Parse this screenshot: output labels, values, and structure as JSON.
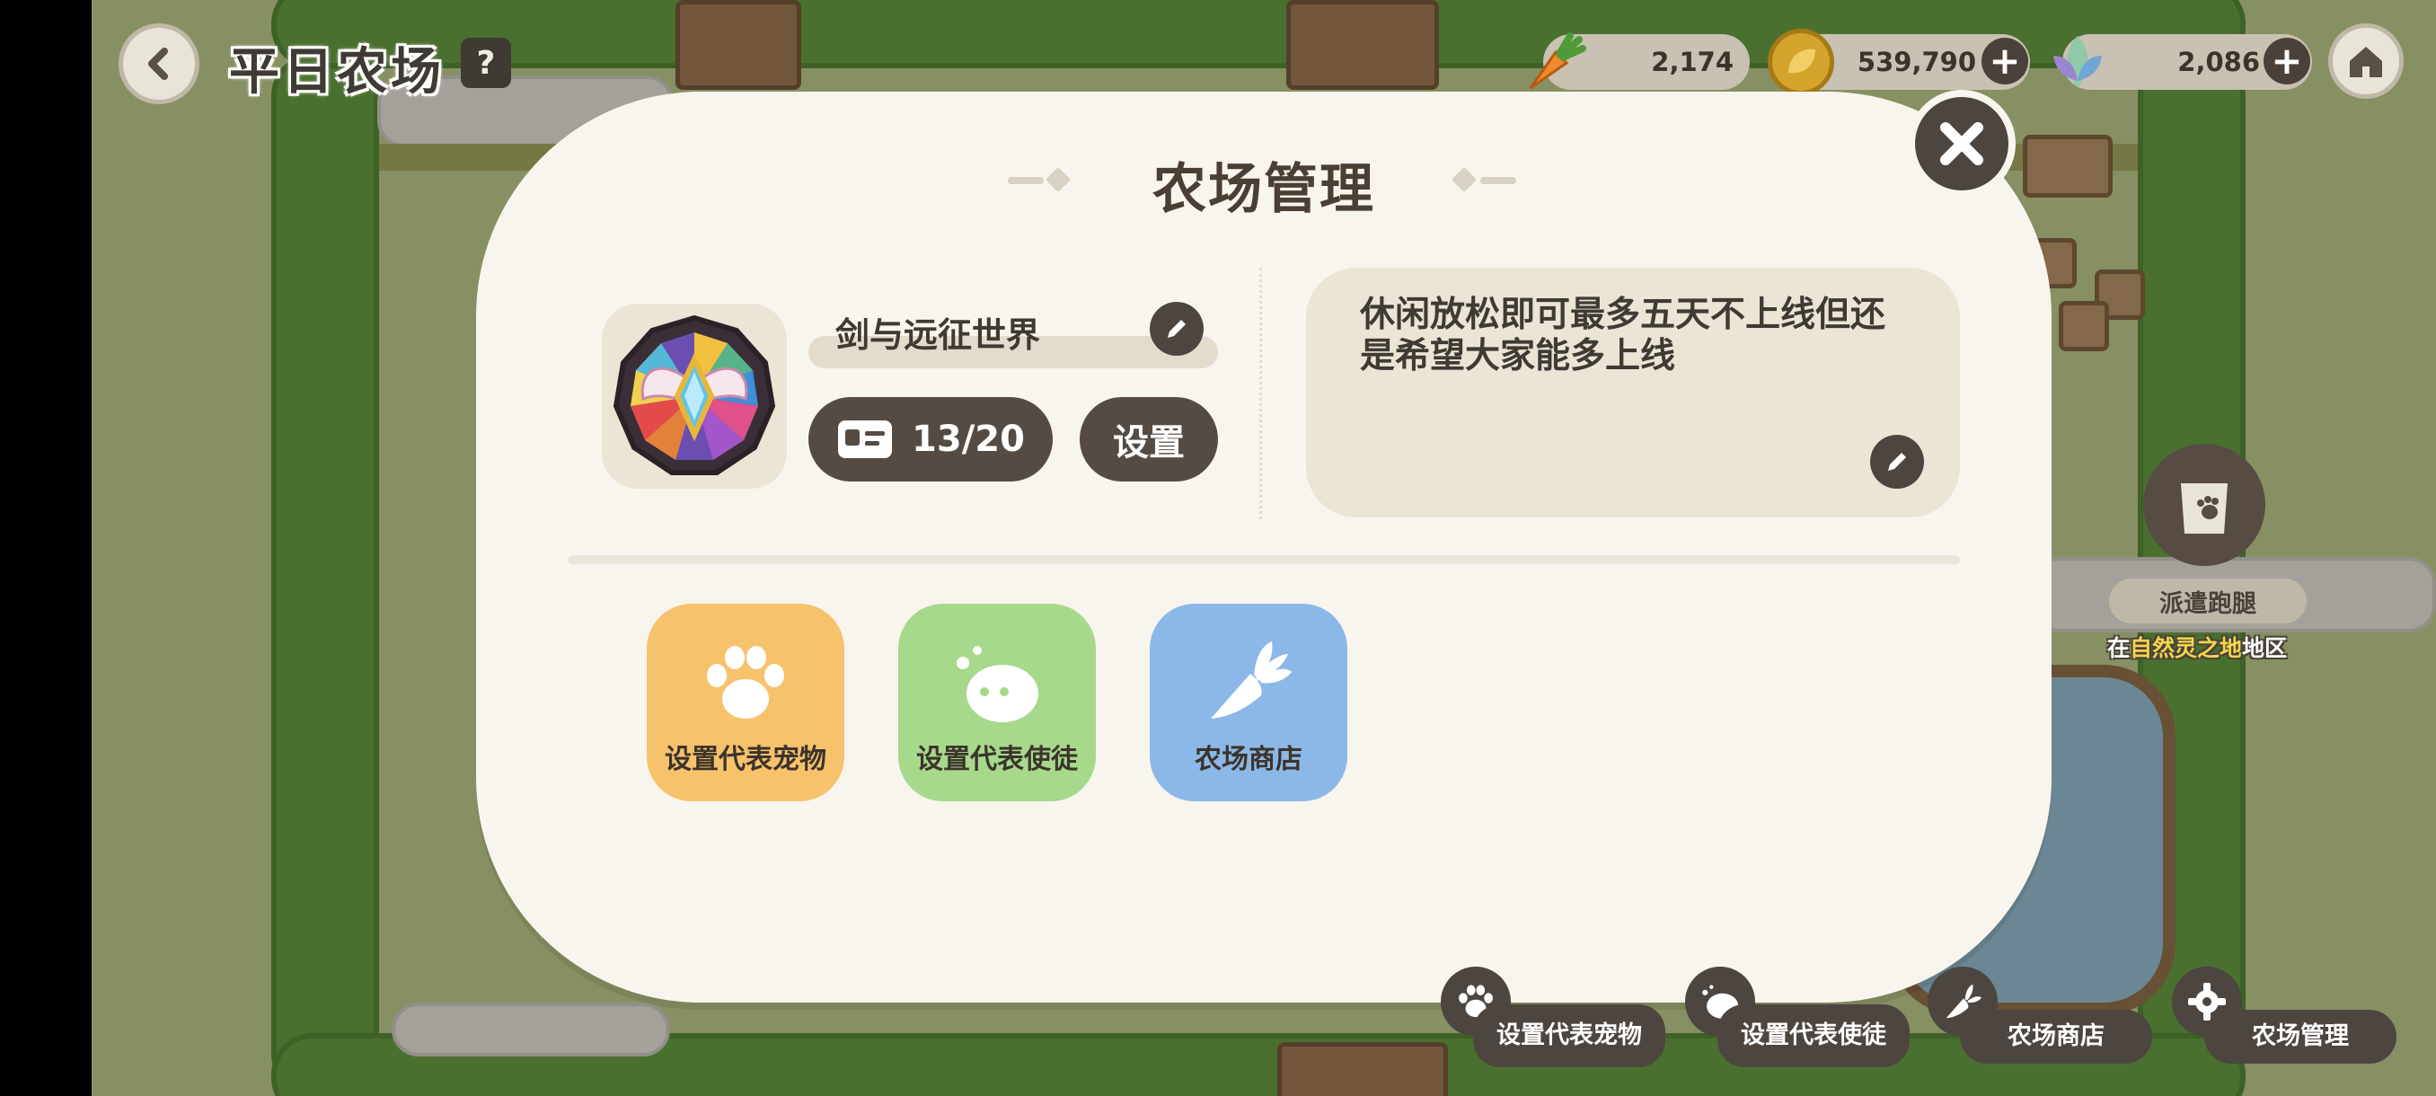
{
  "header": {
    "title": "平日农场",
    "help_icon": "?"
  },
  "resources": [
    {
      "icon": "carrot-icon",
      "value": "2,174"
    },
    {
      "icon": "leaf-coin-icon",
      "value": "539,790"
    },
    {
      "icon": "crystal-leaf-icon",
      "value": "2,086"
    }
  ],
  "modal": {
    "title": "农场管理",
    "farm_name": "剑与远征世界",
    "members": "13/20",
    "settings_label": "设置",
    "description": "休闲放松即可最多五天不上线但还是希望大家能多上线",
    "actions": [
      {
        "label": "设置代表宠物",
        "icon": "paw-icon",
        "color": "#f7c26c"
      },
      {
        "label": "设置代表使徒",
        "icon": "spirit-icon",
        "color": "#a6d98b"
      },
      {
        "label": "农场商店",
        "icon": "carrot-icon",
        "color": "#8cb8e8"
      }
    ]
  },
  "side": {
    "dispatch_label": "派遣跑腿",
    "dispatch_sub_prefix": "在",
    "dispatch_sub_highlight": "自然灵之地",
    "dispatch_sub_suffix": "地区"
  },
  "bottom_bar": {
    "pet": "设置代表宠物",
    "apostle": "设置代表使徒",
    "shop": "农场商店",
    "manage": "农场管理"
  },
  "colors": {
    "modal_bg": "#f8f5ee",
    "dark_button": "#544b44",
    "grass": "#b9c98a",
    "hedge": "#5f9a3e"
  }
}
